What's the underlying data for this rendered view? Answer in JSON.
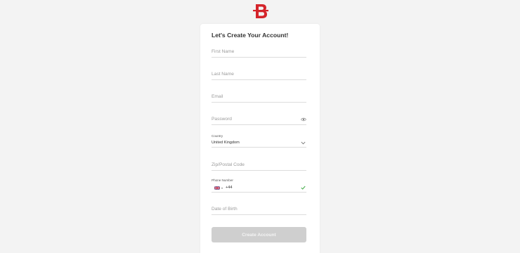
{
  "brand": {
    "logo_letter": "B",
    "accent": "#d4242b"
  },
  "form": {
    "title": "Let's Create Your Account!",
    "first_name_placeholder": "First Name",
    "last_name_placeholder": "Last Name",
    "email_placeholder": "Email",
    "password_placeholder": "Password",
    "country_label": "Country",
    "country_value": "United Kingdom",
    "zip_placeholder": "Zip/Postal Code",
    "phone_label": "Phone Number",
    "phone_dial_code": "+44",
    "phone_caret": "▾",
    "dob_placeholder": "Date of Birth",
    "submit_label": "Create Account"
  },
  "icons": {
    "password_toggle": "eye-icon",
    "country_dropdown": "chevron-down-icon",
    "phone_valid": "check-icon",
    "phone_flag": "uk-flag-icon"
  },
  "colors": {
    "background": "#f3f3f3",
    "card": "#ffffff",
    "button_disabled": "#cfcfcf",
    "valid_check": "#4caf50"
  }
}
